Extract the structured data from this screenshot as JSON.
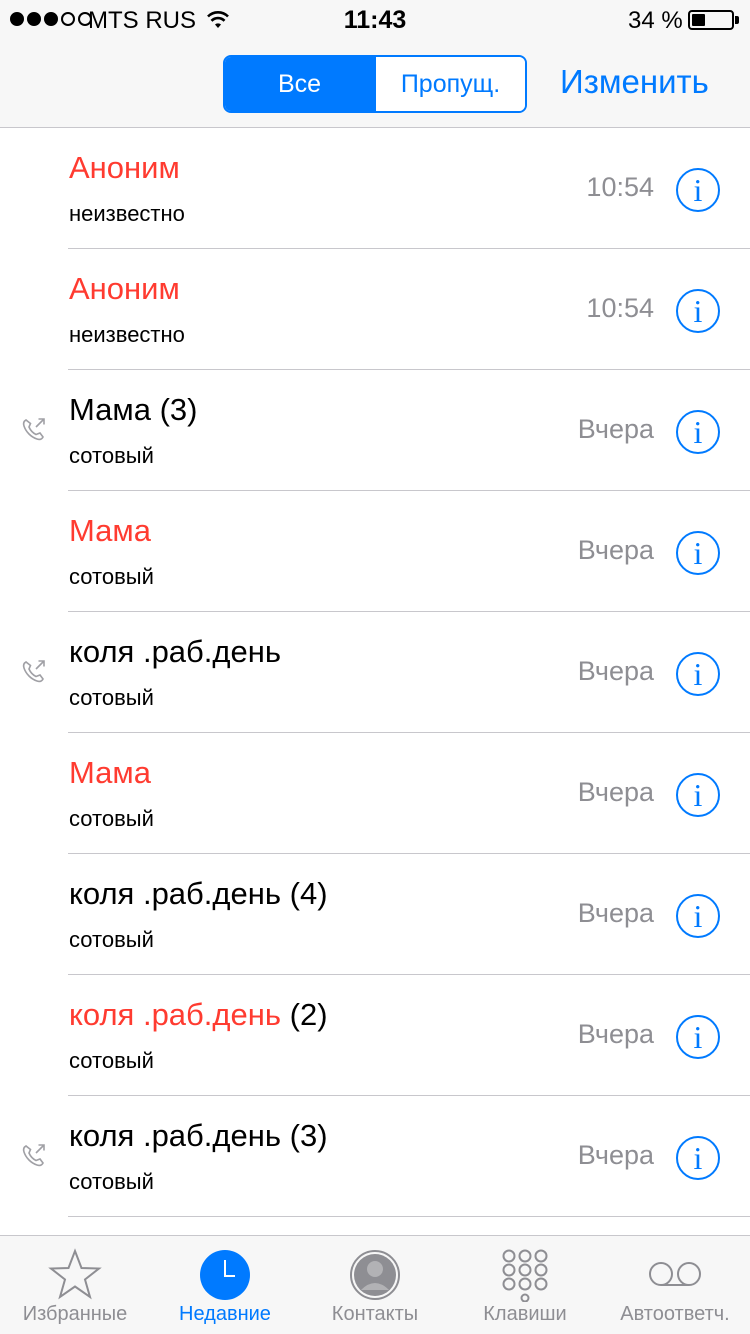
{
  "status_bar": {
    "carrier": "MTS RUS",
    "time": "11:43",
    "battery_text": "34 %",
    "battery_level": 0.34,
    "signal_bars_filled": 3,
    "signal_bars_total": 5
  },
  "nav": {
    "segments": [
      {
        "label": "Все",
        "active": true
      },
      {
        "label": "Пропущ.",
        "active": false
      }
    ],
    "edit_label": "Изменить"
  },
  "calls": [
    {
      "name": "Аноним",
      "count": "",
      "missed": true,
      "outgoing": false,
      "type": "неизвестно",
      "time": "10:54"
    },
    {
      "name": "Аноним",
      "count": "",
      "missed": true,
      "outgoing": false,
      "type": "неизвестно",
      "time": "10:54"
    },
    {
      "name": "Мама",
      "count": "(3)",
      "missed": false,
      "outgoing": true,
      "type": "сотовый",
      "time": "Вчера"
    },
    {
      "name": "Мама",
      "count": "",
      "missed": true,
      "outgoing": false,
      "type": "сотовый",
      "time": "Вчера"
    },
    {
      "name": "коля .раб.день",
      "count": "",
      "missed": false,
      "outgoing": true,
      "type": "сотовый",
      "time": "Вчера"
    },
    {
      "name": "Мама",
      "count": "",
      "missed": true,
      "outgoing": false,
      "type": "сотовый",
      "time": "Вчера"
    },
    {
      "name": "коля .раб.день",
      "count": "(4)",
      "missed": false,
      "outgoing": false,
      "type": "сотовый",
      "time": "Вчера"
    },
    {
      "name": "коля .раб.день",
      "count": "(2)",
      "missed": true,
      "outgoing": false,
      "type": "сотовый",
      "time": "Вчера"
    },
    {
      "name": "коля .раб.день",
      "count": "(3)",
      "missed": false,
      "outgoing": true,
      "type": "сотовый",
      "time": "Вчера"
    }
  ],
  "info_glyph": "i",
  "tabs": [
    {
      "label": "Избранные",
      "icon": "star-icon",
      "active": false
    },
    {
      "label": "Недавние",
      "icon": "clock-icon",
      "active": true
    },
    {
      "label": "Контакты",
      "icon": "contact-icon",
      "active": false
    },
    {
      "label": "Клавиши",
      "icon": "keypad-icon",
      "active": false
    },
    {
      "label": "Автоответч.",
      "icon": "voicemail-icon",
      "active": false
    }
  ],
  "colors": {
    "accent": "#007aff",
    "missed": "#ff3b30",
    "secondary": "#8e8e93"
  }
}
